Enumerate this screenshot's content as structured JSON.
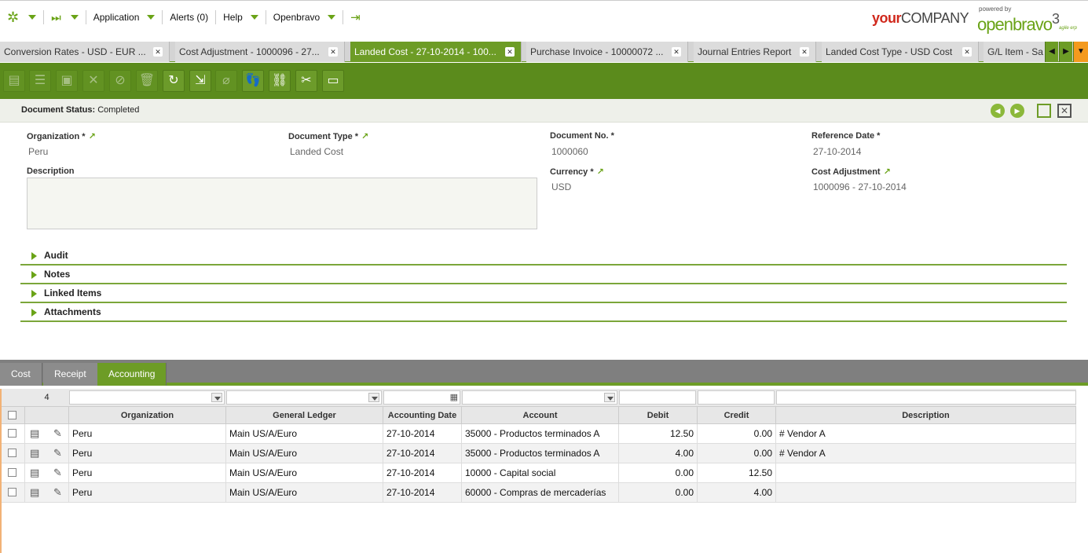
{
  "nav": {
    "application": "Application",
    "alerts": "Alerts (0)",
    "help": "Help",
    "user": "Openbravo"
  },
  "brand": {
    "company_bold": "your",
    "company_rest": "COMPANY",
    "powered_by": "powered by",
    "openbravo": "openbravo",
    "version": "3",
    "tagline": "agile erp"
  },
  "tabs": [
    {
      "label": "Conversion Rates - USD - EUR ..."
    },
    {
      "label": "Cost Adjustment - 1000096 - 27..."
    },
    {
      "label": "Landed Cost - 27-10-2014 - 100..."
    },
    {
      "label": "Purchase Invoice - 10000072 ..."
    },
    {
      "label": "Journal Entries Report"
    },
    {
      "label": "Landed Cost Type - USD Cost"
    },
    {
      "label": "G/L Item - Sa"
    }
  ],
  "toolbar_icons": [
    "new-document-icon",
    "new-row-icon",
    "save-icon",
    "undo-icon",
    "cancel-icon",
    "delete-icon",
    "refresh-icon",
    "export-icon",
    "attach-icon",
    "audit-trail-icon",
    "link-icon",
    "tools-icon",
    "grid-view-icon"
  ],
  "status": {
    "label": "Document Status:",
    "value": "Completed"
  },
  "fields": {
    "organization": {
      "label": "Organization *",
      "value": "Peru"
    },
    "document_type": {
      "label": "Document Type *",
      "value": "Landed Cost"
    },
    "document_no": {
      "label": "Document No. *",
      "value": "1000060"
    },
    "reference_date": {
      "label": "Reference Date *",
      "value": "27-10-2014"
    },
    "description": {
      "label": "Description",
      "value": ""
    },
    "currency": {
      "label": "Currency *",
      "value": "USD"
    },
    "cost_adjustment": {
      "label": "Cost Adjustment",
      "value": "1000096 - 27-10-2014"
    }
  },
  "sections": [
    "Audit",
    "Notes",
    "Linked Items",
    "Attachments"
  ],
  "subtabs": [
    {
      "label": "Cost"
    },
    {
      "label": "Receipt"
    },
    {
      "label": "Accounting"
    }
  ],
  "grid": {
    "row_count": "4",
    "columns": [
      "Organization",
      "General Ledger",
      "Accounting Date",
      "Account",
      "Debit",
      "Credit",
      "Description"
    ],
    "rows": [
      [
        "Peru",
        "Main US/A/Euro",
        "27-10-2014",
        "35000 - Productos terminados A",
        "12.50",
        "0.00",
        "# Vendor A"
      ],
      [
        "Peru",
        "Main US/A/Euro",
        "27-10-2014",
        "35000 - Productos terminados A",
        "4.00",
        "0.00",
        "# Vendor A"
      ],
      [
        "Peru",
        "Main US/A/Euro",
        "27-10-2014",
        "10000 - Capital social",
        "0.00",
        "12.50",
        ""
      ],
      [
        "Peru",
        "Main US/A/Euro",
        "27-10-2014",
        "60000 - Compras de mercaderías",
        "0.00",
        "4.00",
        ""
      ]
    ]
  }
}
